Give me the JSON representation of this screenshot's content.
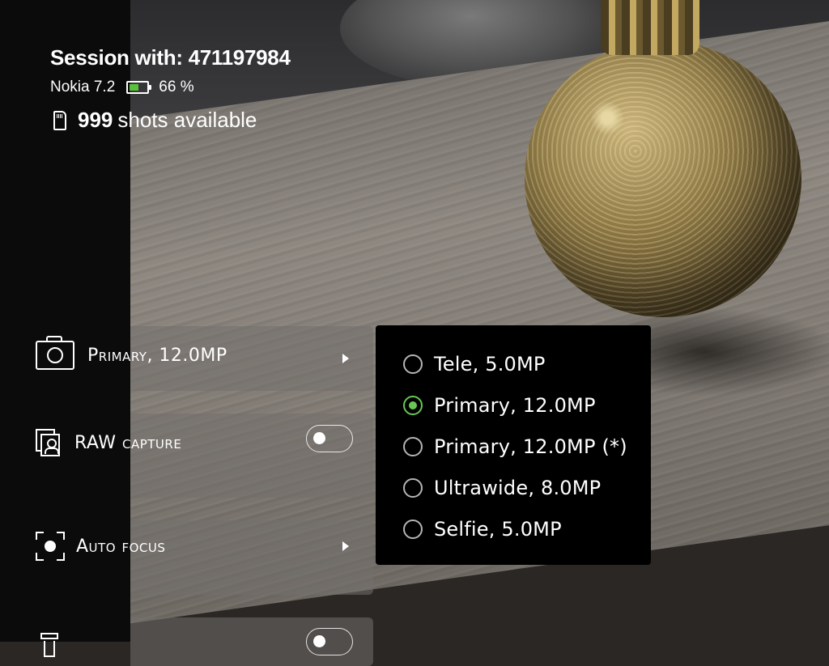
{
  "session": {
    "title": "Session with: 471197984",
    "device_name": "Nokia 7.2",
    "battery_icon": "battery-icon",
    "battery_percent": 66,
    "battery_text": "66 %",
    "battery_color": "#59c23b",
    "storage_icon": "sd-card-icon",
    "shots_count": "999",
    "shots_text": "shots available"
  },
  "settings": [
    {
      "id": "camera",
      "icon": "camera-icon",
      "label": "Primary, 12.0MP",
      "control": "submenu-arrow"
    },
    {
      "id": "raw",
      "icon": "raw-capture-icon",
      "label": "RAW capture",
      "control": "toggle",
      "on": false
    },
    {
      "id": "focus",
      "icon": "auto-focus-icon",
      "label": "Auto focus",
      "control": "submenu-arrow"
    },
    {
      "id": "flash",
      "icon": "flash-icon",
      "label": "",
      "control": "toggle",
      "on": false
    }
  ],
  "camera_menu": {
    "options": [
      {
        "label": "Tele, 5.0MP",
        "selected": false
      },
      {
        "label": "Primary, 12.0MP",
        "selected": true
      },
      {
        "label": "Primary, 12.0MP (*)",
        "selected": false
      },
      {
        "label": "Ultrawide, 8.0MP",
        "selected": false
      },
      {
        "label": "Selfie, 5.0MP",
        "selected": false
      }
    ],
    "selected_color": "#69c754"
  }
}
